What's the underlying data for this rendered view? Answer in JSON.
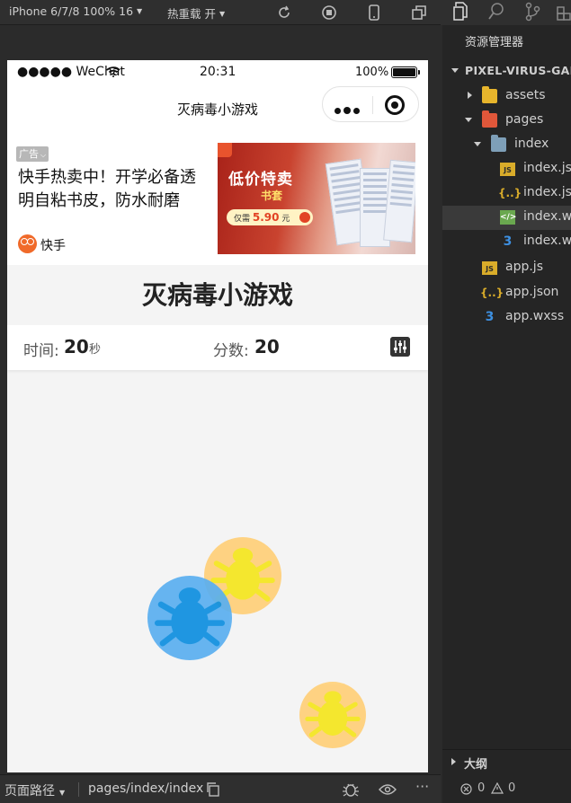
{
  "toolbar": {
    "device": "iPhone 6/7/8 100% 16",
    "hot_reload": "热重载 开"
  },
  "status_bar": {
    "carrier": "●●●●● WeChat",
    "time": "20:31",
    "battery": "100%"
  },
  "navbar": {
    "title": "灭病毒小游戏"
  },
  "ad": {
    "tag": "广告",
    "text": "快手热卖中！开学必备透明自粘书皮，防水耐磨",
    "brand": "快手",
    "image_headline": "低价特卖",
    "image_sub": "书套",
    "image_price_prefix": "仅需",
    "image_price": "5.90",
    "image_price_unit": "元"
  },
  "game": {
    "title": "灭病毒小游戏",
    "time_label": "时间:",
    "time_value": "20",
    "time_unit": "秒",
    "score_label": "分数:",
    "score_value": "20",
    "viruses": [
      {
        "color": "yellow",
        "halo": "#ffd079",
        "body": "#f5e61e"
      },
      {
        "color": "blue",
        "halo": "#5aaff0",
        "body": "#0d8fe0"
      },
      {
        "color": "yellow",
        "halo": "#ffd079",
        "body": "#f5e61e"
      }
    ]
  },
  "bottom_bar": {
    "route_label": "页面路径",
    "route_path": "pages/index/index"
  },
  "explorer": {
    "title": "资源管理器",
    "project": "PIXEL-VIRUS-GAME",
    "tree": [
      {
        "label": "assets",
        "type": "folder",
        "icon": "folder-yellow-icon"
      },
      {
        "label": "pages",
        "type": "folder",
        "icon": "folder-red-icon"
      },
      {
        "label": "index",
        "type": "folder",
        "icon": "folder-blue-icon"
      },
      {
        "label": "index.js",
        "type": "js"
      },
      {
        "label": "index.json",
        "type": "json"
      },
      {
        "label": "index.wxml",
        "type": "wxml"
      },
      {
        "label": "index.wxss",
        "type": "wxss"
      },
      {
        "label": "app.js",
        "type": "js"
      },
      {
        "label": "app.json",
        "type": "json"
      },
      {
        "label": "app.wxss",
        "type": "wxss"
      }
    ],
    "outline": "大纲",
    "errors": "0",
    "warnings": "0"
  },
  "colors": {
    "ide_bg": "#2b2b2b",
    "phone_bg": "#f4f4f4",
    "virus_yellow": "#f5e61e",
    "virus_blue": "#0d8fe0"
  }
}
